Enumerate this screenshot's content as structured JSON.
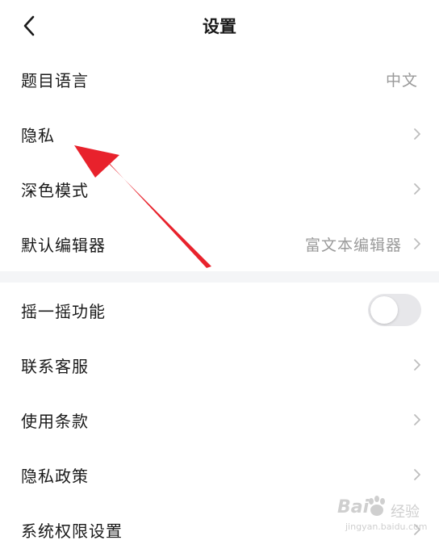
{
  "header": {
    "title": "设置",
    "back_icon": "chevron-left-icon"
  },
  "section1": {
    "items": [
      {
        "label": "题目语言",
        "value": "中文",
        "chevron": false
      },
      {
        "label": "隐私",
        "value": "",
        "chevron": true
      },
      {
        "label": "深色模式",
        "value": "",
        "chevron": true
      },
      {
        "label": "默认编辑器",
        "value": "富文本编辑器",
        "chevron": true
      }
    ]
  },
  "section2": {
    "items": [
      {
        "label": "摇一摇功能",
        "type": "toggle",
        "on": false
      },
      {
        "label": "联系客服",
        "chevron": true
      },
      {
        "label": "使用条款",
        "chevron": true
      },
      {
        "label": "隐私政策",
        "chevron": true
      },
      {
        "label": "系统权限设置",
        "chevron": true
      }
    ]
  },
  "colors": {
    "background": "#ffffff",
    "section_gap": "#f4f5f7",
    "text_primary": "#1a1a1a",
    "text_secondary": "#9a9a9a",
    "chevron": "#bdbdbd",
    "toggle_off": "#e7e7ea",
    "annotation_arrow": "#e8222c"
  },
  "watermark": {
    "brand": "Bai",
    "brand_tail": "经验",
    "domain": "jingyan.baidu.com"
  }
}
